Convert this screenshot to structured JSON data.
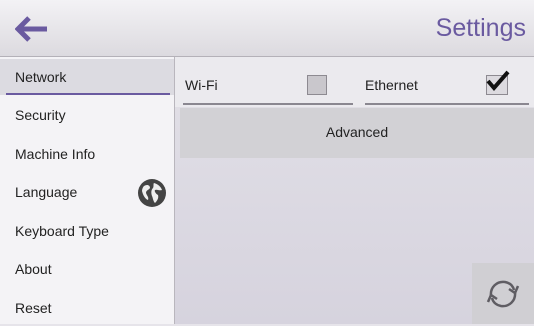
{
  "header": {
    "title": "Settings",
    "back_icon": "arrow-left-icon"
  },
  "sidebar": {
    "items": [
      {
        "label": "Network",
        "active": true
      },
      {
        "label": "Security"
      },
      {
        "label": "Machine Info"
      },
      {
        "label": "Language",
        "icon": "globe-icon"
      },
      {
        "label": "Keyboard Type"
      },
      {
        "label": "About"
      },
      {
        "label": "Reset"
      }
    ]
  },
  "network": {
    "wifi": {
      "label": "Wi-Fi",
      "checked": false
    },
    "ethernet": {
      "label": "Ethernet",
      "checked": true
    },
    "advanced_label": "Advanced"
  },
  "sync_icon": "sync-icon",
  "colors": {
    "accent": "#6a5aa0"
  }
}
